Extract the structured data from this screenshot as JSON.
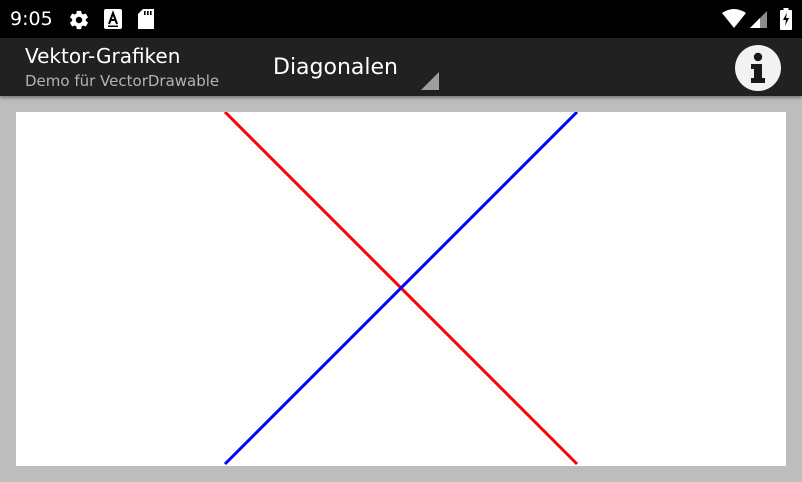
{
  "status_bar": {
    "time": "9:05",
    "left_icons": [
      "gear-icon",
      "text-format-icon",
      "sd-card-icon"
    ],
    "right_icons": [
      "wifi-icon",
      "cell-signal-icon",
      "battery-charging-icon"
    ]
  },
  "action_bar": {
    "title": "Vektor-Grafiken",
    "subtitle": "Demo für VectorDrawable",
    "spinner": {
      "selected": "Diagonalen"
    },
    "info_icon": "info-icon"
  },
  "drawing": {
    "lines": [
      {
        "name": "diagonal-top-left-to-bottom-right",
        "color": "#ff0000"
      },
      {
        "name": "diagonal-bottom-left-to-top-right",
        "color": "#0000ff"
      }
    ]
  },
  "colors": {
    "status_bar": "#000000",
    "action_bar": "#212121",
    "background": "#bdbdbd",
    "canvas": "#ffffff",
    "red_line": "#ff0000",
    "blue_line": "#0000ff"
  }
}
